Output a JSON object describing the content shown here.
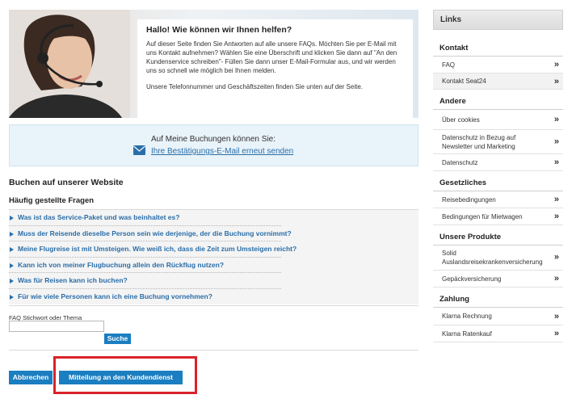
{
  "hero": {
    "title": "Hallo! Wie können wir Ihnen helfen?",
    "text": "Auf dieser Seite finden Sie Antworten auf alle unsere FAQs. Möchten Sie per E-Mail mit uns Kontakt aufnehmen? Wählen Sie eine Überschrift und klicken Sie dann auf \"An den Kundenservice schreiben\"- Füllen Sie dann unser E-Mail-Formular aus, und wir werden uns so schnell wie möglich bei Ihnen melden.",
    "text2": "Unsere Telefonnummer und Geschäftszeiten finden Sie unten auf der Seite."
  },
  "bookings": {
    "label": "Auf Meine Buchungen können Sie:",
    "link": "Ihre Bestätigungs-E-Mail erneut senden"
  },
  "faq": {
    "section_title": "Buchen auf unserer Website",
    "subtitle": "Häufig gestellte Fragen",
    "items": [
      "Was ist das Service-Paket und was beinhaltet es?",
      "Muss der Reisende dieselbe Person sein wie derjenige, der die Buchung vornimmt?",
      "Meine Flugreise ist mit Umsteigen. Wie weiß ich, dass die Zeit zum Umsteigen reicht?",
      "Kann ich von meiner Flugbuchung allein den Rückflug nutzen?",
      "Was für Reisen kann ich buchen?",
      "Für wie viele Personen kann ich eine Buchung vornehmen?"
    ],
    "search_label": "FAQ Stichwort oder Thema",
    "search_value": "",
    "search_button": "Suche"
  },
  "buttons": {
    "cancel": "Abbrechen",
    "message": "Mitteilung an den Kundendienst"
  },
  "sidebar": {
    "header": "Links",
    "arrow": "»",
    "groups": [
      {
        "title": "Kontakt",
        "items": [
          "FAQ",
          "Kontakt Seat24"
        ]
      },
      {
        "title": "Andere",
        "items": [
          "Über cookies",
          "Datenschutz in Bezug auf Newsletter und Marketing",
          "Datenschutz"
        ]
      },
      {
        "title": "Gesetzliches",
        "items": [
          "Reisebedingungen",
          "Bedingungen für Mietwagen"
        ]
      },
      {
        "title": "Unsere Produkte",
        "items": [
          "Solid Auslandsreisekrankenversicherung",
          "Gepäckversicherung"
        ]
      },
      {
        "title": "Zahlung",
        "items": [
          "Klarna Rechnung",
          "Klarna Ratenkauf"
        ]
      }
    ]
  },
  "colors": {
    "accent": "#1a7ec1",
    "link": "#2a6ea8",
    "highlight": "#d9232a"
  }
}
